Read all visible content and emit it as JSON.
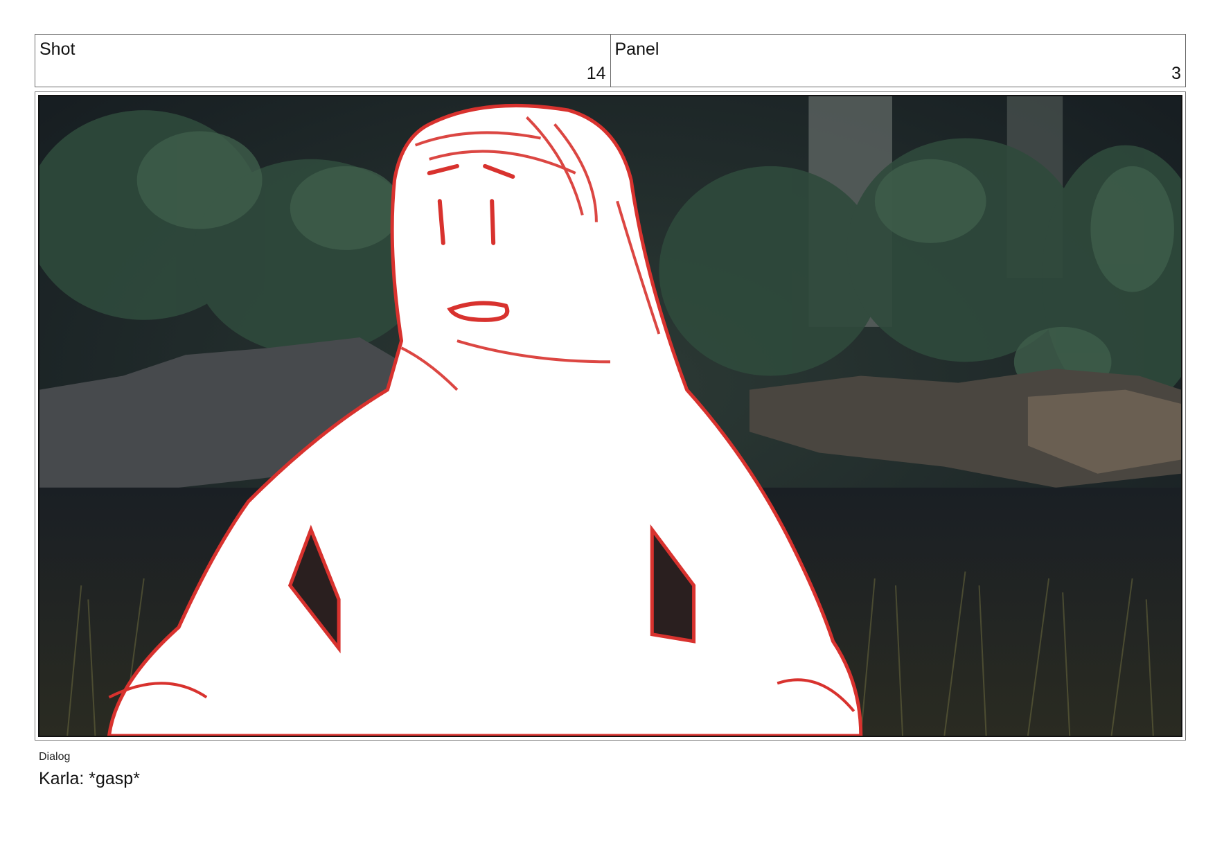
{
  "header": {
    "shot_label": "Shot",
    "shot_number": "14",
    "panel_label": "Panel",
    "panel_number": "3"
  },
  "frame": {
    "description_icon": "storyboard-sketch-image"
  },
  "dialog": {
    "label": "Dialog",
    "text": "Karla: *gasp*"
  },
  "colors": {
    "sketch_red": "#d8322e",
    "foliage_dark": "#1e2a26",
    "rock_gray": "#4a4d50"
  }
}
